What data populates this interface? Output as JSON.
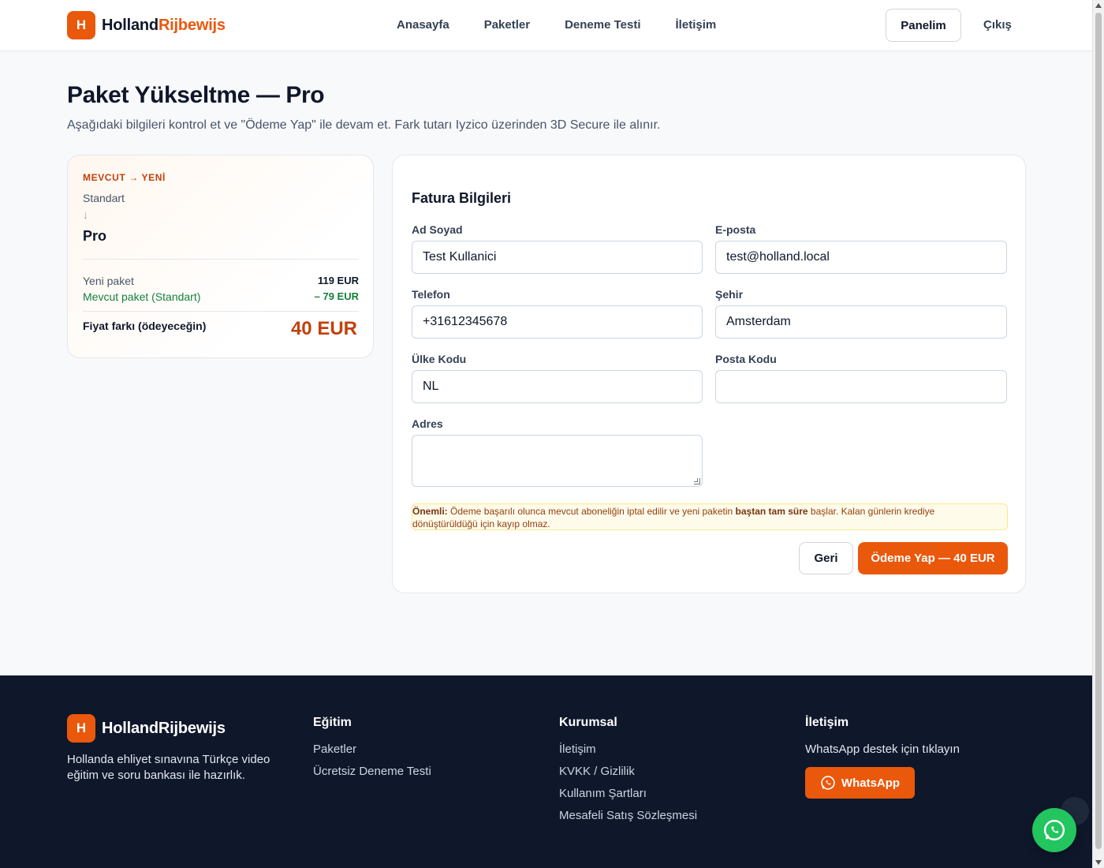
{
  "header": {
    "logo_badge": "H",
    "logo_text_main": "Holland",
    "logo_text_accent": "Rijbewijs",
    "nav": [
      "Anasayfa",
      "Paketler",
      "Deneme Testi",
      "İletişim"
    ],
    "panel_label": "Panelim",
    "logout_label": "Çıkış"
  },
  "page": {
    "title": "Paket Yükseltme — Pro",
    "subtitle": "Aşağıdaki bilgileri kontrol et ve \"Ödeme Yap\" ile devam et. Fark tutarı Iyzico üzerinden 3D Secure ile alınır."
  },
  "summary": {
    "eyebrow": "MEVCUT → YENİ",
    "current_package": "Standart",
    "arrow": "↓",
    "new_package": "Pro",
    "new_package_label": "Yeni paket",
    "new_package_price": "119 EUR",
    "current_package_label": "Mevcut paket (Standart)",
    "current_package_price": "– 79 EUR",
    "difference_label": "Fiyat farkı (ödeyeceğin)",
    "difference_value": "40 EUR"
  },
  "form": {
    "title": "Fatura Bilgileri",
    "fields": {
      "name": {
        "label": "Ad Soyad",
        "value": "Test Kullanici"
      },
      "email": {
        "label": "E-posta",
        "value": "test@holland.local"
      },
      "phone": {
        "label": "Telefon",
        "value": "+31612345678"
      },
      "city": {
        "label": "Şehir",
        "value": "Amsterdam"
      },
      "country": {
        "label": "Ülke Kodu",
        "value": "NL"
      },
      "postal": {
        "label": "Posta Kodu",
        "value": ""
      },
      "address": {
        "label": "Adres",
        "value": ""
      }
    },
    "notice_strong": "Önemli:",
    "notice_text_1": " Ödeme başarılı olunca mevcut aboneliğin iptal edilir ve yeni paketin ",
    "notice_bold": "baştan tam süre",
    "notice_text_2": " başlar. Kalan günlerin krediye dönüştürüldüğü için kayıp olmaz.",
    "back_label": "Geri",
    "pay_label": "Ödeme Yap — 40 EUR"
  },
  "footer": {
    "logo_badge": "H",
    "logo_text": "HollandRijbewijs",
    "description": "Hollanda ehliyet sınavına Türkçe video eğitim ve soru bankası ile hazırlık.",
    "education_title": "Eğitim",
    "education_links": [
      "Paketler",
      "Ücretsiz Deneme Testi"
    ],
    "corporate_title": "Kurumsal",
    "corporate_links": [
      "İletişim",
      "KVKK / Gizlilik",
      "Kullanım Şartları",
      "Mesafeli Satış Sözleşmesi"
    ],
    "contact_title": "İletişim",
    "contact_text": "WhatsApp destek için tıklayın",
    "whatsapp_label": "WhatsApp"
  },
  "colors": {
    "brand": "#ea580c",
    "footer_bg": "#0f172a",
    "whatsapp": "#22c55e",
    "credit_green": "#15803d"
  },
  "icons": [
    "whatsapp-icon",
    "arrow-down-icon"
  ]
}
